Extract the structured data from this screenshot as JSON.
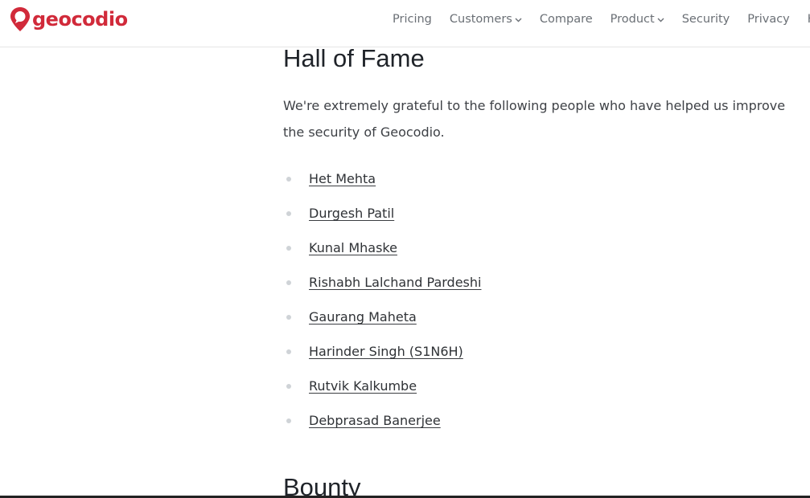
{
  "header": {
    "logo_text": "geocodio",
    "brand_color": "#d12a3a",
    "nav": [
      {
        "label": "Pricing",
        "dropdown": false
      },
      {
        "label": "Customers",
        "dropdown": true
      },
      {
        "label": "Compare",
        "dropdown": false
      },
      {
        "label": "Product",
        "dropdown": true
      },
      {
        "label": "Security",
        "dropdown": false
      },
      {
        "label": "Privacy",
        "dropdown": false
      },
      {
        "label": "H",
        "dropdown": false
      }
    ]
  },
  "main": {
    "title": "Hall of Fame",
    "intro": "We're extremely grateful to the following people who have helped us improve the security of Geocodio.",
    "people": [
      "Het Mehta",
      "Durgesh Patil",
      "Kunal Mhaske",
      "Rishabh Lalchand Pardeshi",
      "Gaurang Maheta",
      "Harinder Singh (S1N6H)",
      "Rutvik Kalkumbe",
      "Debprasad Banerjee"
    ],
    "next_section_title": "Bounty"
  }
}
